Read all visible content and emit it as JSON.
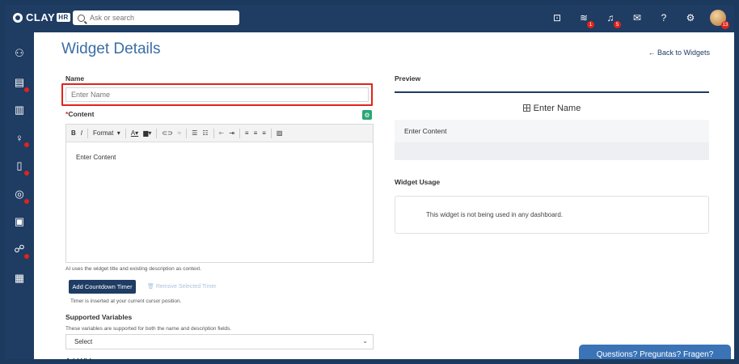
{
  "app": {
    "logo_text": "CLAY",
    "logo_suffix": "HR"
  },
  "search": {
    "placeholder": "Ask or search"
  },
  "topbar": {
    "icons": [
      {
        "name": "calendar-icon",
        "glyph": "⊡"
      },
      {
        "name": "layers-icon",
        "glyph": "≋",
        "badge": "1"
      },
      {
        "name": "bell-icon",
        "glyph": "♫",
        "badge": "5"
      },
      {
        "name": "mail-icon",
        "glyph": "✉"
      },
      {
        "name": "help-icon",
        "glyph": "?"
      },
      {
        "name": "gear-icon",
        "glyph": "⚙"
      }
    ],
    "avatar_badge": "13"
  },
  "page": {
    "title": "Widget Details",
    "back_link": "← Back to Widgets"
  },
  "form": {
    "name_label": "Name",
    "name_placeholder": "Enter Name",
    "content_label": "Content",
    "content_required_mark": "*",
    "toolbar_format": "Format",
    "editor_text": "Enter Content",
    "ai_hint": "AI uses the widget title and existing description as context.",
    "add_timer_label": "Add Countdown Timer",
    "remove_timer_label": "Remove Selected Timer",
    "timer_hint": "Timer is inserted at your current cursor position.",
    "variables_label": "Supported Variables",
    "variables_hint": "These variables are supported for both the name and description fields.",
    "variables_select": "Select",
    "add_video_label": "Add Video"
  },
  "preview": {
    "label": "Preview",
    "name_text": "Enter Name",
    "content_text": "Enter Content",
    "usage_label": "Widget Usage",
    "usage_text": "This widget is not being used in any dashboard."
  },
  "help": {
    "label": "Questions? Preguntas? Fragen?"
  },
  "colors": {
    "navy": "#1f3c63",
    "accent_blue": "#3a6ea5",
    "alert_red": "#e2231a",
    "ai_green": "#2aa775"
  }
}
